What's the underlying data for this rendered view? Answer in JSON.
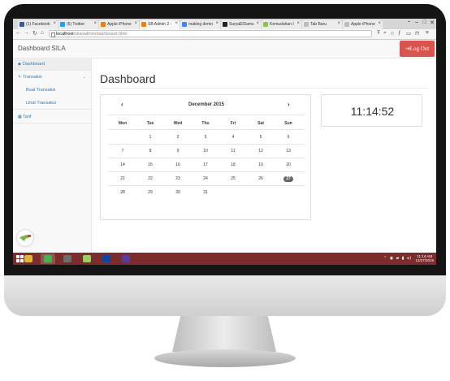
{
  "browser": {
    "tabs": [
      {
        "label": "(1) Facebook",
        "icon": "facebook-icon",
        "color": "#3b5998"
      },
      {
        "label": "(6) Twitter",
        "icon": "twitter-icon",
        "color": "#1da1f2"
      },
      {
        "label": "Apple iPhone",
        "icon": "blogger-icon",
        "color": "#f57d00"
      },
      {
        "label": "SB Admin 2 -",
        "icon": "sb-admin-icon",
        "color": "#f57d00"
      },
      {
        "label": "making demo",
        "icon": "google-icon",
        "color": "#4285f4"
      },
      {
        "label": "SuryaElDams",
        "icon": "github-icon",
        "color": "#222222"
      },
      {
        "label": "Kemudahan I",
        "icon": "leaf-icon",
        "color": "#8bc34a"
      },
      {
        "label": "Tab Baru",
        "icon": "page-icon",
        "color": "#bdbdbd"
      },
      {
        "label": "Apple iPhone",
        "icon": "page-icon",
        "color": "#bdbdbd"
      }
    ],
    "url_host": "localhost",
    "url_path": "/sila/admin/dashboard.html"
  },
  "app": {
    "brand": "Dashboard SILA",
    "logout_label": "Log Out",
    "page_title": "Dashboard"
  },
  "sidebar": {
    "items": [
      {
        "label": "Dashboard",
        "icon": "dashboard-icon"
      },
      {
        "label": "Transaksi",
        "icon": "edit-icon"
      },
      {
        "label": "Buat Transaksi"
      },
      {
        "label": "Lihat Transaksi"
      },
      {
        "label": "Tarif",
        "icon": "table-icon"
      }
    ]
  },
  "calendar": {
    "month": "December 2015",
    "prev": "‹",
    "next": "›",
    "weekdays": [
      "Mon",
      "Tue",
      "Wed",
      "Thu",
      "Fri",
      "Sat",
      "Sun"
    ],
    "weeks": [
      [
        "",
        "1",
        "2",
        "3",
        "4",
        "5",
        "6"
      ],
      [
        "7",
        "8",
        "9",
        "10",
        "11",
        "12",
        "13"
      ],
      [
        "14",
        "15",
        "16",
        "17",
        "18",
        "19",
        "20"
      ],
      [
        "21",
        "22",
        "23",
        "24",
        "25",
        "26",
        "27"
      ],
      [
        "28",
        "29",
        "30",
        "31",
        "",
        "",
        ""
      ]
    ],
    "today": "27"
  },
  "clock": "11:14:52",
  "taskbar": {
    "apps": [
      {
        "icon": "file-explorer-icon",
        "color": "#e3b341",
        "active": false
      },
      {
        "icon": "chrome-icon",
        "color": "#4caf50",
        "active": true
      },
      {
        "icon": "media-icon",
        "color": "#6d6d6d",
        "active": false
      },
      {
        "icon": "android-icon",
        "color": "#9ccc65",
        "active": false
      },
      {
        "icon": "photoshop-icon",
        "color": "#0d47a1",
        "active": false
      },
      {
        "icon": "app-icon",
        "color": "#5c3d99",
        "active": false
      }
    ],
    "time": "11:14 AM",
    "date": "12/27/2015"
  }
}
